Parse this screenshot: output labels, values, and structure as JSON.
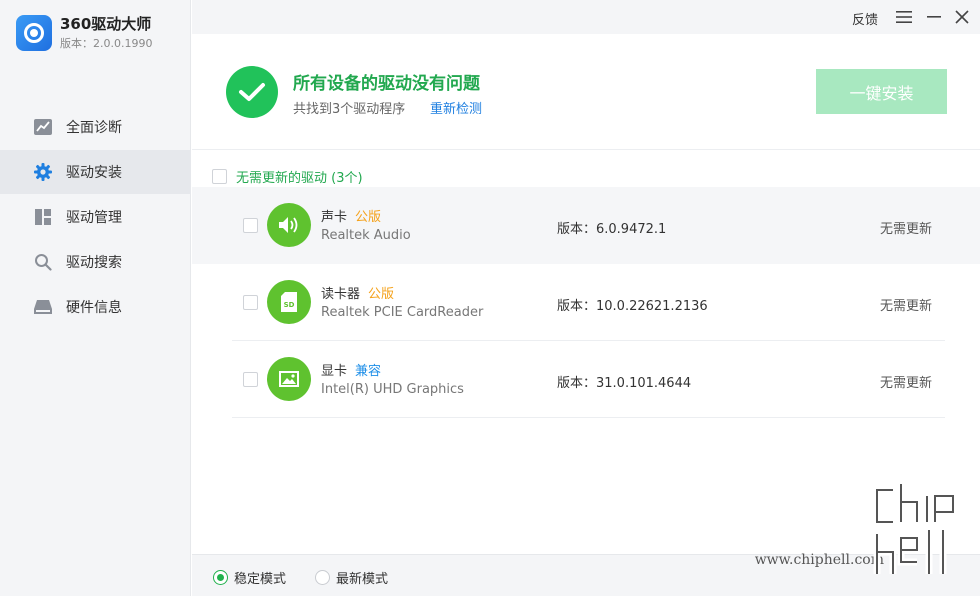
{
  "app": {
    "title": "360驱动大师",
    "version": "版本：2.0.0.1990"
  },
  "sidebar": {
    "items": [
      {
        "label": "全面诊断",
        "icon": "trend-chart-icon"
      },
      {
        "label": "驱动安装",
        "icon": "gear-icon"
      },
      {
        "label": "驱动管理",
        "icon": "grid-icon"
      },
      {
        "label": "驱动搜索",
        "icon": "search-icon"
      },
      {
        "label": "硬件信息",
        "icon": "hardware-icon"
      }
    ],
    "active_index": 1
  },
  "titlebar": {
    "feedback": "反馈"
  },
  "header": {
    "title": "所有设备的驱动没有问题",
    "subtitle": "共找到3个驱动程序",
    "recheck": "重新检测",
    "install_button": "一键安装"
  },
  "group": {
    "label": "无需更新的驱动 (3个)"
  },
  "drivers": [
    {
      "name": "声卡",
      "tag": "公版",
      "model": "Realtek Audio",
      "version": "版本：6.0.9472.1",
      "status": "无需更新",
      "icon": "speaker-icon"
    },
    {
      "name": "读卡器",
      "tag": "公版",
      "model": "Realtek PCIE CardReader",
      "version": "版本：10.0.22621.2136",
      "status": "无需更新",
      "icon": "sd-card-icon"
    },
    {
      "name": "显卡",
      "tag": "兼容",
      "model": "Intel(R) UHD Graphics",
      "version": "版本：31.0.101.4644",
      "status": "无需更新",
      "icon": "image-icon"
    }
  ],
  "footer": {
    "stable_mode": "稳定模式",
    "latest_mode": "最新模式",
    "selected": "stable"
  },
  "watermark": {
    "url": "www.chiphell.com",
    "logo_text": "chip hell"
  },
  "colors": {
    "accent_green": "#22a84f",
    "link_blue": "#1f7fe0",
    "tag_orange": "#f5a21b"
  }
}
